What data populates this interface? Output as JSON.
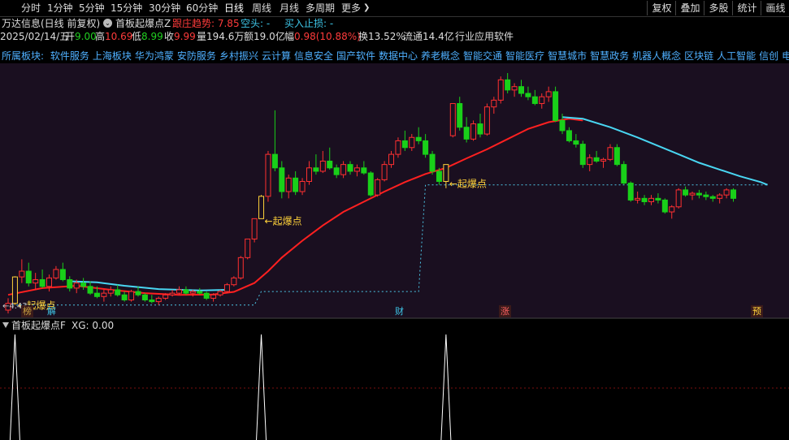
{
  "toolbar": {
    "periods": [
      {
        "label": "分时",
        "active": false
      },
      {
        "label": "1分钟",
        "active": false
      },
      {
        "label": "5分钟",
        "active": false
      },
      {
        "label": "15分钟",
        "active": false
      },
      {
        "label": "30分钟",
        "active": false
      },
      {
        "label": "60分钟",
        "active": false
      },
      {
        "label": "日线",
        "active": true
      },
      {
        "label": "周线",
        "active": false
      },
      {
        "label": "月线",
        "active": false
      },
      {
        "label": "多周期",
        "active": false
      },
      {
        "label": "更多",
        "active": false
      }
    ],
    "right_buttons": [
      "复权",
      "叠加",
      "多股",
      "统计",
      "画线"
    ],
    "more_caret": "❯"
  },
  "header": {
    "stock": "万达信息(日线 前复权)",
    "indicator_name": "首板起爆点Z",
    "trend_label": "跟庄趋势: 7.85",
    "empty_label": "空头: -",
    "stop_label": "买入止损: -"
  },
  "quote": {
    "date": "2025/02/14/五",
    "open_label": "开",
    "open": "9.00",
    "high_label": "高",
    "high": "10.69",
    "low_label": "低",
    "low": "8.99",
    "close_label": "收",
    "close": "9.99",
    "vol_label": "量",
    "vol": "194.6万",
    "amt_label": "额",
    "amt": "19.0亿",
    "chg_label": "幅",
    "chg": "0.98(10.88%)",
    "turnover_label": "换",
    "turnover": "13.52%",
    "float_label": "流通",
    "float": "14.4亿",
    "industry": "行业应用软件"
  },
  "sectors": {
    "prefix": "所属板块:",
    "items": [
      "软件服务",
      "上海板块",
      "华为鸿蒙",
      "安防服务",
      "乡村振兴",
      "云计算",
      "信息安全",
      "国产软件",
      "数据中心",
      "养老概念",
      "智能交通",
      "智能医疗",
      "智慧城市",
      "智慧政务",
      "机器人概念",
      "区块链",
      "人工智能",
      "信创",
      "电子身"
    ]
  },
  "annotations": {
    "qibao": "起爆点",
    "left_low": "4.43"
  },
  "markers": [
    "榜",
    "解",
    "财",
    "涨",
    "预"
  ],
  "lower_panel": {
    "title": "首板起爆点F",
    "xg_label": "XG: 0.00"
  },
  "colors": {
    "background": "#000000",
    "chart_bg": "#1a0f20",
    "up": "#ff3030",
    "down": "#19d019",
    "ma_red": "#ff2020",
    "ma_cyan": "#49d6f2",
    "signal": "#ffd23a",
    "dashed": "#4cc6e6"
  },
  "icons": {
    "dropdown": "circle-chevron-icon",
    "lower_dropdown": "small-triangle-icon"
  },
  "chart_data": {
    "type": "candlestick",
    "candles": [
      [
        3.9,
        4.25,
        3.8,
        4.1
      ],
      [
        4.1,
        4.9,
        4.05,
        4.88
      ],
      [
        4.88,
        5.4,
        4.7,
        5.05
      ],
      [
        5.05,
        5.3,
        4.6,
        4.7
      ],
      [
        4.7,
        5.0,
        4.5,
        4.8
      ],
      [
        4.8,
        5.1,
        4.55,
        4.6
      ],
      [
        4.6,
        4.95,
        4.45,
        4.85
      ],
      [
        4.85,
        5.2,
        4.8,
        5.1
      ],
      [
        5.1,
        5.3,
        4.75,
        4.8
      ],
      [
        4.8,
        4.9,
        4.45,
        4.55
      ],
      [
        4.55,
        4.8,
        4.4,
        4.7
      ],
      [
        4.7,
        4.85,
        4.5,
        4.6
      ],
      [
        4.6,
        4.75,
        4.35,
        4.4
      ],
      [
        4.4,
        4.6,
        4.25,
        4.3
      ],
      [
        4.3,
        4.5,
        4.15,
        4.4
      ],
      [
        4.4,
        4.6,
        4.3,
        4.5
      ],
      [
        4.5,
        4.65,
        4.3,
        4.35
      ],
      [
        4.35,
        4.45,
        4.15,
        4.2
      ],
      [
        4.2,
        4.5,
        4.15,
        4.45
      ],
      [
        4.45,
        4.6,
        4.3,
        4.35
      ],
      [
        4.35,
        4.4,
        4.15,
        4.2
      ],
      [
        4.2,
        4.35,
        4.1,
        4.15
      ],
      [
        4.15,
        4.3,
        4.05,
        4.25
      ],
      [
        4.25,
        4.4,
        4.2,
        4.35
      ],
      [
        4.35,
        4.5,
        4.3,
        4.4
      ],
      [
        4.4,
        4.6,
        4.35,
        4.5
      ],
      [
        4.5,
        4.6,
        4.35,
        4.4
      ],
      [
        4.4,
        4.5,
        4.3,
        4.45
      ],
      [
        4.45,
        4.55,
        4.35,
        4.4
      ],
      [
        4.4,
        4.45,
        4.2,
        4.25
      ],
      [
        4.25,
        4.4,
        4.15,
        4.35
      ],
      [
        4.35,
        4.5,
        4.3,
        4.45
      ],
      [
        4.45,
        4.7,
        4.4,
        4.65
      ],
      [
        4.65,
        4.9,
        4.6,
        4.85
      ],
      [
        4.85,
        5.5,
        4.8,
        5.45
      ],
      [
        5.45,
        6.0,
        5.4,
        6.0
      ],
      [
        6.0,
        6.6,
        5.9,
        6.6
      ],
      [
        6.6,
        7.3,
        6.6,
        7.26
      ],
      [
        7.26,
        8.6,
        7.1,
        8.5
      ],
      [
        8.5,
        9.8,
        8.0,
        8.1
      ],
      [
        8.1,
        8.3,
        7.2,
        7.4
      ],
      [
        7.4,
        7.9,
        7.2,
        7.8
      ],
      [
        7.8,
        8.0,
        7.3,
        7.4
      ],
      [
        7.4,
        7.8,
        7.3,
        7.7
      ],
      [
        7.7,
        8.3,
        7.6,
        8.1
      ],
      [
        8.1,
        8.5,
        7.9,
        8.0
      ],
      [
        8.0,
        8.6,
        7.95,
        8.3
      ],
      [
        8.3,
        8.7,
        8.05,
        8.1
      ],
      [
        8.1,
        8.2,
        7.8,
        7.9
      ],
      [
        7.9,
        8.3,
        7.8,
        8.2
      ],
      [
        8.2,
        8.3,
        7.9,
        8.0
      ],
      [
        8.0,
        8.2,
        7.85,
        8.1
      ],
      [
        8.1,
        8.3,
        7.9,
        7.95
      ],
      [
        7.95,
        8.0,
        7.25,
        7.3
      ],
      [
        7.3,
        7.8,
        7.25,
        7.75
      ],
      [
        7.75,
        8.3,
        7.7,
        8.2
      ],
      [
        8.2,
        8.6,
        8.1,
        8.5
      ],
      [
        8.5,
        9.0,
        8.4,
        8.9
      ],
      [
        8.9,
        9.2,
        8.6,
        8.7
      ],
      [
        8.7,
        9.1,
        8.6,
        9.0
      ],
      [
        9.0,
        9.3,
        8.8,
        8.9
      ],
      [
        8.9,
        9.1,
        8.4,
        8.5
      ],
      [
        8.5,
        8.6,
        7.9,
        8.0
      ],
      [
        8.0,
        8.1,
        7.6,
        7.7
      ],
      [
        7.7,
        8.2,
        7.5,
        8.2
      ],
      [
        9.05,
        10.0,
        9.0,
        10.0
      ],
      [
        10.0,
        10.2,
        9.2,
        9.3
      ],
      [
        9.3,
        9.6,
        8.85,
        8.95
      ],
      [
        8.95,
        9.5,
        8.9,
        9.4
      ],
      [
        9.4,
        9.7,
        9.0,
        9.1
      ],
      [
        9.1,
        10.0,
        9.05,
        9.9
      ],
      [
        9.9,
        10.2,
        9.7,
        10.1
      ],
      [
        10.1,
        10.8,
        10.0,
        10.7
      ],
      [
        10.7,
        10.9,
        10.3,
        10.4
      ],
      [
        10.4,
        10.6,
        10.2,
        10.5
      ],
      [
        10.5,
        10.7,
        10.2,
        10.3
      ],
      [
        10.3,
        10.5,
        10.1,
        10.2
      ],
      [
        10.2,
        10.4,
        9.95,
        10.0
      ],
      [
        10.0,
        10.3,
        9.85,
        10.2
      ],
      [
        10.2,
        10.5,
        10.05,
        10.35
      ],
      [
        10.35,
        10.5,
        9.45,
        9.5
      ],
      [
        9.5,
        9.7,
        9.1,
        9.2
      ],
      [
        9.2,
        9.3,
        8.85,
        8.9
      ],
      [
        8.9,
        9.1,
        8.7,
        8.8
      ],
      [
        8.8,
        8.9,
        8.1,
        8.2
      ],
      [
        8.2,
        8.5,
        8.0,
        8.4
      ],
      [
        8.4,
        8.6,
        8.25,
        8.3
      ],
      [
        8.3,
        8.4,
        8.1,
        8.35
      ],
      [
        8.35,
        8.8,
        8.3,
        8.7
      ],
      [
        8.7,
        8.8,
        8.15,
        8.2
      ],
      [
        8.2,
        8.3,
        7.6,
        7.65
      ],
      [
        7.65,
        7.7,
        7.1,
        7.15
      ],
      [
        7.15,
        7.4,
        7.05,
        7.2
      ],
      [
        7.2,
        7.3,
        7.0,
        7.1
      ],
      [
        7.1,
        7.3,
        7.0,
        7.2
      ],
      [
        7.2,
        7.35,
        7.05,
        7.15
      ],
      [
        7.15,
        7.2,
        6.75,
        6.8
      ],
      [
        6.8,
        7.0,
        6.6,
        6.95
      ],
      [
        6.95,
        7.5,
        6.9,
        7.45
      ],
      [
        7.45,
        7.55,
        7.25,
        7.3
      ],
      [
        7.3,
        7.4,
        7.15,
        7.35
      ],
      [
        7.35,
        7.45,
        7.2,
        7.3
      ],
      [
        7.3,
        7.4,
        7.15,
        7.25
      ],
      [
        7.25,
        7.3,
        7.1,
        7.2
      ],
      [
        7.2,
        7.35,
        7.05,
        7.3
      ],
      [
        7.3,
        7.5,
        7.2,
        7.45
      ],
      [
        7.45,
        7.5,
        7.1,
        7.2
      ]
    ],
    "ma_red": [
      [
        0,
        4.35
      ],
      [
        5,
        4.55
      ],
      [
        10,
        4.62
      ],
      [
        15,
        4.5
      ],
      [
        20,
        4.4
      ],
      [
        25,
        4.35
      ],
      [
        30,
        4.36
      ],
      [
        33,
        4.44
      ],
      [
        36,
        4.7
      ],
      [
        38,
        5.05
      ],
      [
        40,
        5.45
      ],
      [
        43,
        5.95
      ],
      [
        46,
        6.4
      ],
      [
        49,
        6.8
      ],
      [
        52,
        7.1
      ],
      [
        55,
        7.4
      ],
      [
        58,
        7.68
      ],
      [
        61,
        7.92
      ],
      [
        64,
        8.1
      ],
      [
        67,
        8.38
      ],
      [
        70,
        8.65
      ],
      [
        73,
        8.95
      ],
      [
        76,
        9.25
      ],
      [
        79,
        9.45
      ],
      [
        82,
        9.55
      ],
      [
        84,
        9.5
      ]
    ],
    "ma_cyan": [
      [
        9,
        4.75
      ],
      [
        13,
        4.72
      ],
      [
        17,
        4.62
      ],
      [
        22,
        4.52
      ],
      [
        28,
        4.48
      ],
      [
        32,
        4.5
      ],
      [
        81,
        9.6
      ],
      [
        84,
        9.55
      ],
      [
        88,
        9.3
      ],
      [
        92,
        9.0
      ],
      [
        95,
        8.75
      ],
      [
        98,
        8.5
      ],
      [
        101,
        8.25
      ],
      [
        104,
        8.05
      ],
      [
        107,
        7.85
      ],
      [
        110,
        7.68
      ],
      [
        111,
        7.6
      ]
    ],
    "signals": [
      1,
      37,
      64
    ],
    "stop_line": [
      [
        0,
        4.05
      ],
      [
        36,
        4.05
      ],
      [
        37,
        4.45
      ],
      [
        60,
        4.45
      ],
      [
        61,
        7.6
      ],
      [
        111,
        7.6
      ]
    ],
    "lower_series_peaks": [
      1,
      37,
      64
    ],
    "xg_value": 0.0
  }
}
